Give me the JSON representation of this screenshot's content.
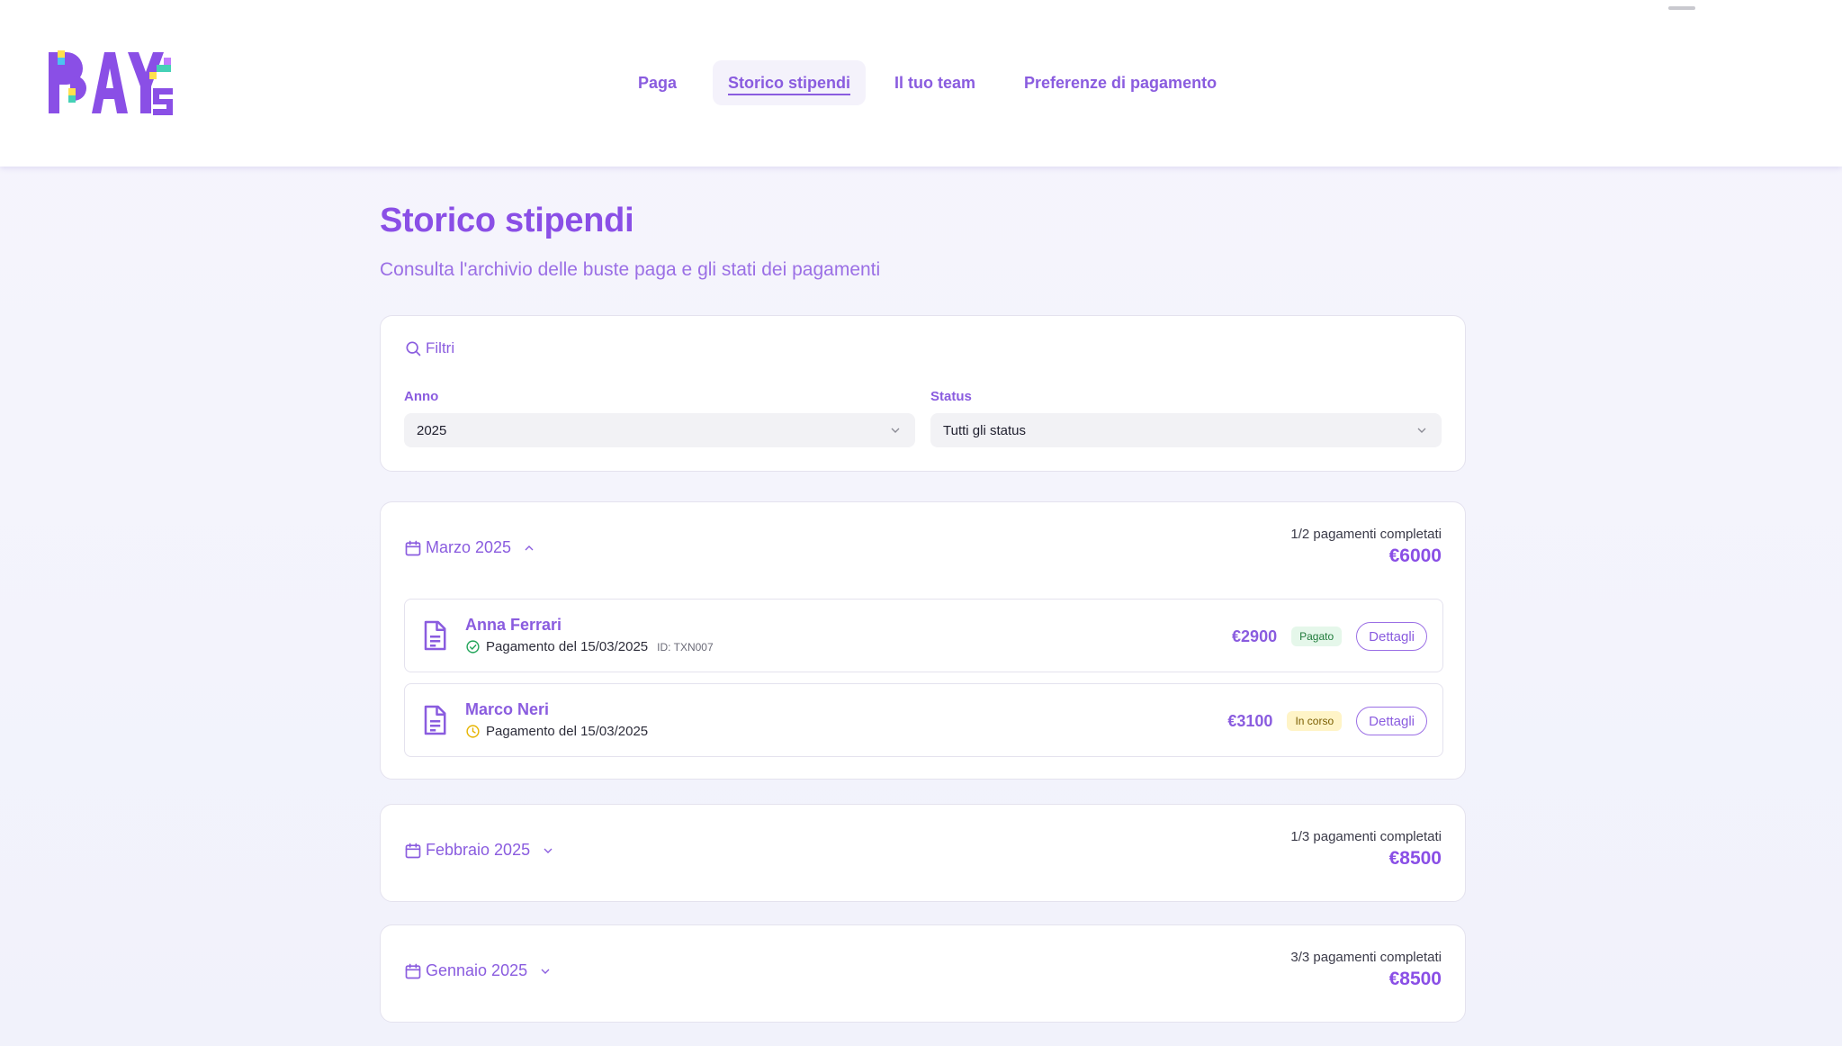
{
  "header": {
    "logo_text": "PAYS",
    "nav": [
      {
        "label": "Paga",
        "active": false
      },
      {
        "label": "Storico stipendi",
        "active": true
      },
      {
        "label": "Il tuo team",
        "active": false
      },
      {
        "label": "Preferenze di pagamento",
        "active": false
      }
    ]
  },
  "page": {
    "title": "Storico stipendi",
    "subtitle": "Consulta l'archivio delle buste paga e gli stati dei pagamenti"
  },
  "filters": {
    "heading": "Filtri",
    "year_label": "Anno",
    "year_value": "2025",
    "status_label": "Status",
    "status_value": "Tutti gli status"
  },
  "months": [
    {
      "label": "Marzo 2025",
      "expanded": true,
      "summary": "1/2 pagamenti completati",
      "total": "€6000",
      "payments": [
        {
          "name": "Anna Ferrari",
          "date": "Pagamento del 15/03/2025",
          "txn": "ID: TXN007",
          "amount": "€2900",
          "status": "Pagato",
          "status_kind": "paid",
          "action": "Dettagli"
        },
        {
          "name": "Marco Neri",
          "date": "Pagamento del 15/03/2025",
          "txn": "",
          "amount": "€3100",
          "status": "In corso",
          "status_kind": "pending",
          "action": "Dettagli"
        }
      ]
    },
    {
      "label": "Febbraio 2025",
      "expanded": false,
      "summary": "1/3 pagamenti completati",
      "total": "€8500"
    },
    {
      "label": "Gennaio 2025",
      "expanded": false,
      "summary": "3/3 pagamenti completati",
      "total": "€8500"
    }
  ],
  "colors": {
    "accent": "#8a5cdf",
    "paid_bg": "#e5f7ea",
    "pending_bg": "#fff4c7",
    "check_icon": "#22a55a",
    "clock_icon": "#e6b400"
  },
  "icons": {
    "search": "search-icon",
    "calendar": "calendar-icon",
    "chevron_up": "chevron-up-icon",
    "chevron_down": "chevron-down-icon",
    "document": "document-icon",
    "check": "check-circle-icon",
    "clock": "clock-icon"
  }
}
